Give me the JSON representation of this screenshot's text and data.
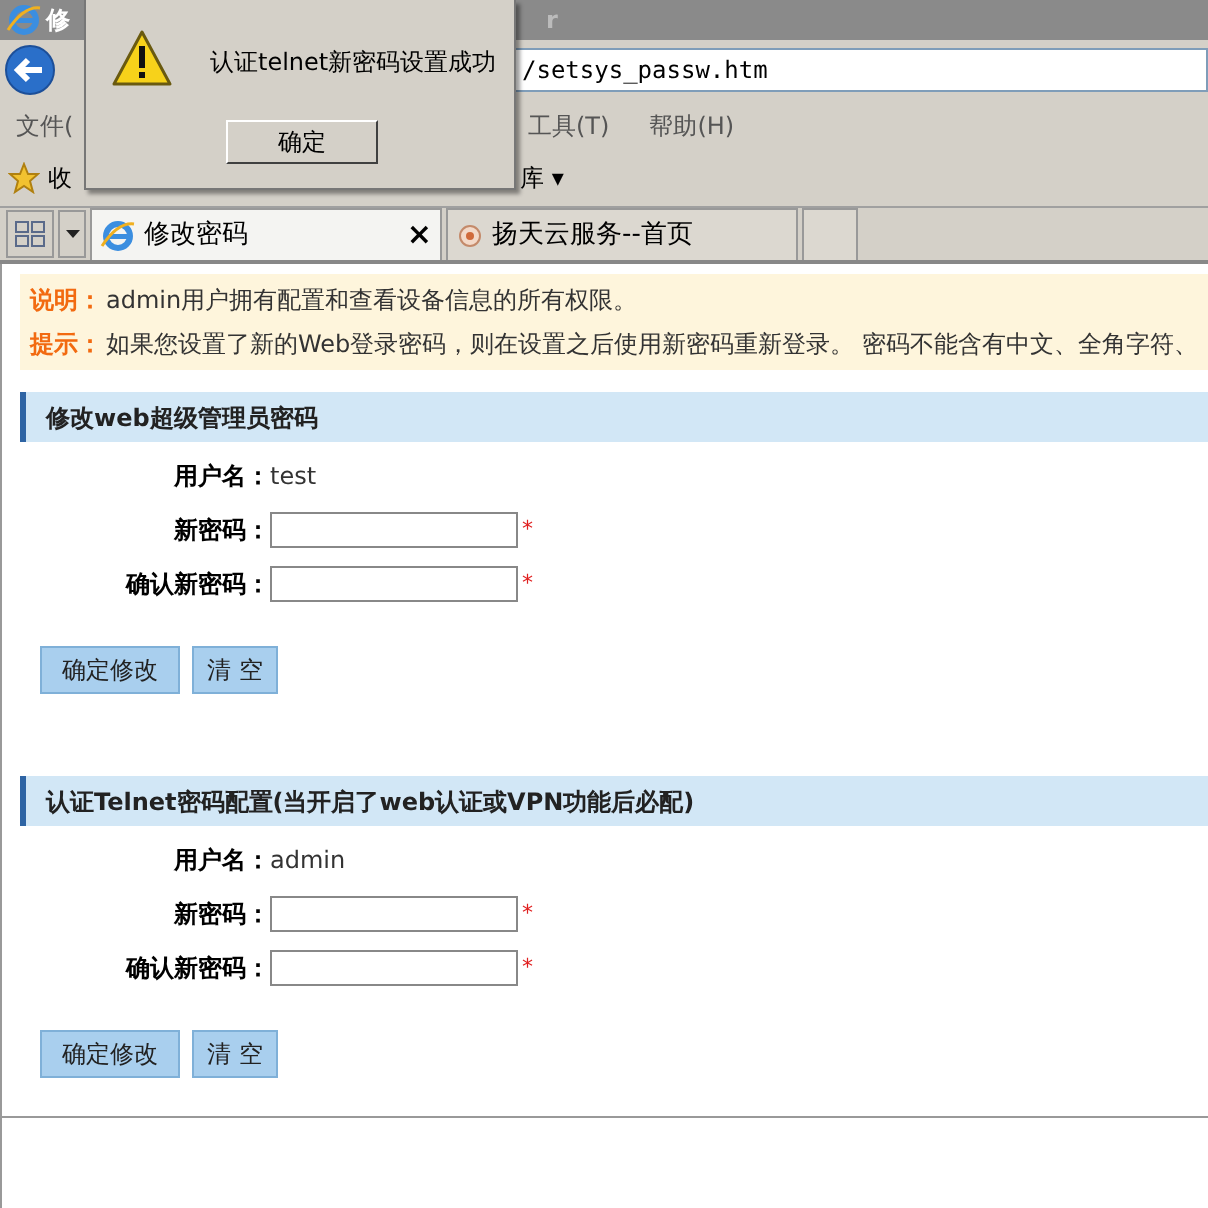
{
  "window": {
    "title_left": "修",
    "title_right": "r"
  },
  "address_bar": {
    "value": "/setsys_passw.htm"
  },
  "menu": [
    "文件(",
    "工具(T)",
    "帮助(H)"
  ],
  "favorites_bar": {
    "left": "收",
    "right": "库 ▾"
  },
  "tabs": [
    {
      "label": "修改密码",
      "selected": true,
      "close": "×"
    },
    {
      "label": "扬天云服务--首页",
      "selected": false
    },
    {
      "selected": false
    }
  ],
  "notice": [
    {
      "label": "说明：",
      "text": "admin用户拥有配置和查看设备信息的所有权限。"
    },
    {
      "label": "提示：",
      "text": "如果您设置了新的Web登录密码，则在设置之后使用新密码重新登录。 密码不能含有中文、全角字符、"
    }
  ],
  "sections": [
    {
      "title": "修改web超级管理员密码",
      "username_label": "用户名：",
      "username": "test",
      "fields": [
        {
          "label": "新密码：",
          "required": "*"
        },
        {
          "label": "确认新密码：",
          "required": "*"
        }
      ],
      "buttons": [
        "确定修改",
        "清 空"
      ]
    },
    {
      "title": "认证Telnet密码配置(当开启了web认证或VPN功能后必配)",
      "username_label": "用户名：",
      "username": "admin",
      "fields": [
        {
          "label": "新密码：",
          "required": "*"
        },
        {
          "label": "确认新密码：",
          "required": "*"
        }
      ],
      "buttons": [
        "确定修改",
        "清 空"
      ]
    }
  ],
  "dialog": {
    "message": "认证telnet新密码设置成功",
    "button": "确定"
  }
}
